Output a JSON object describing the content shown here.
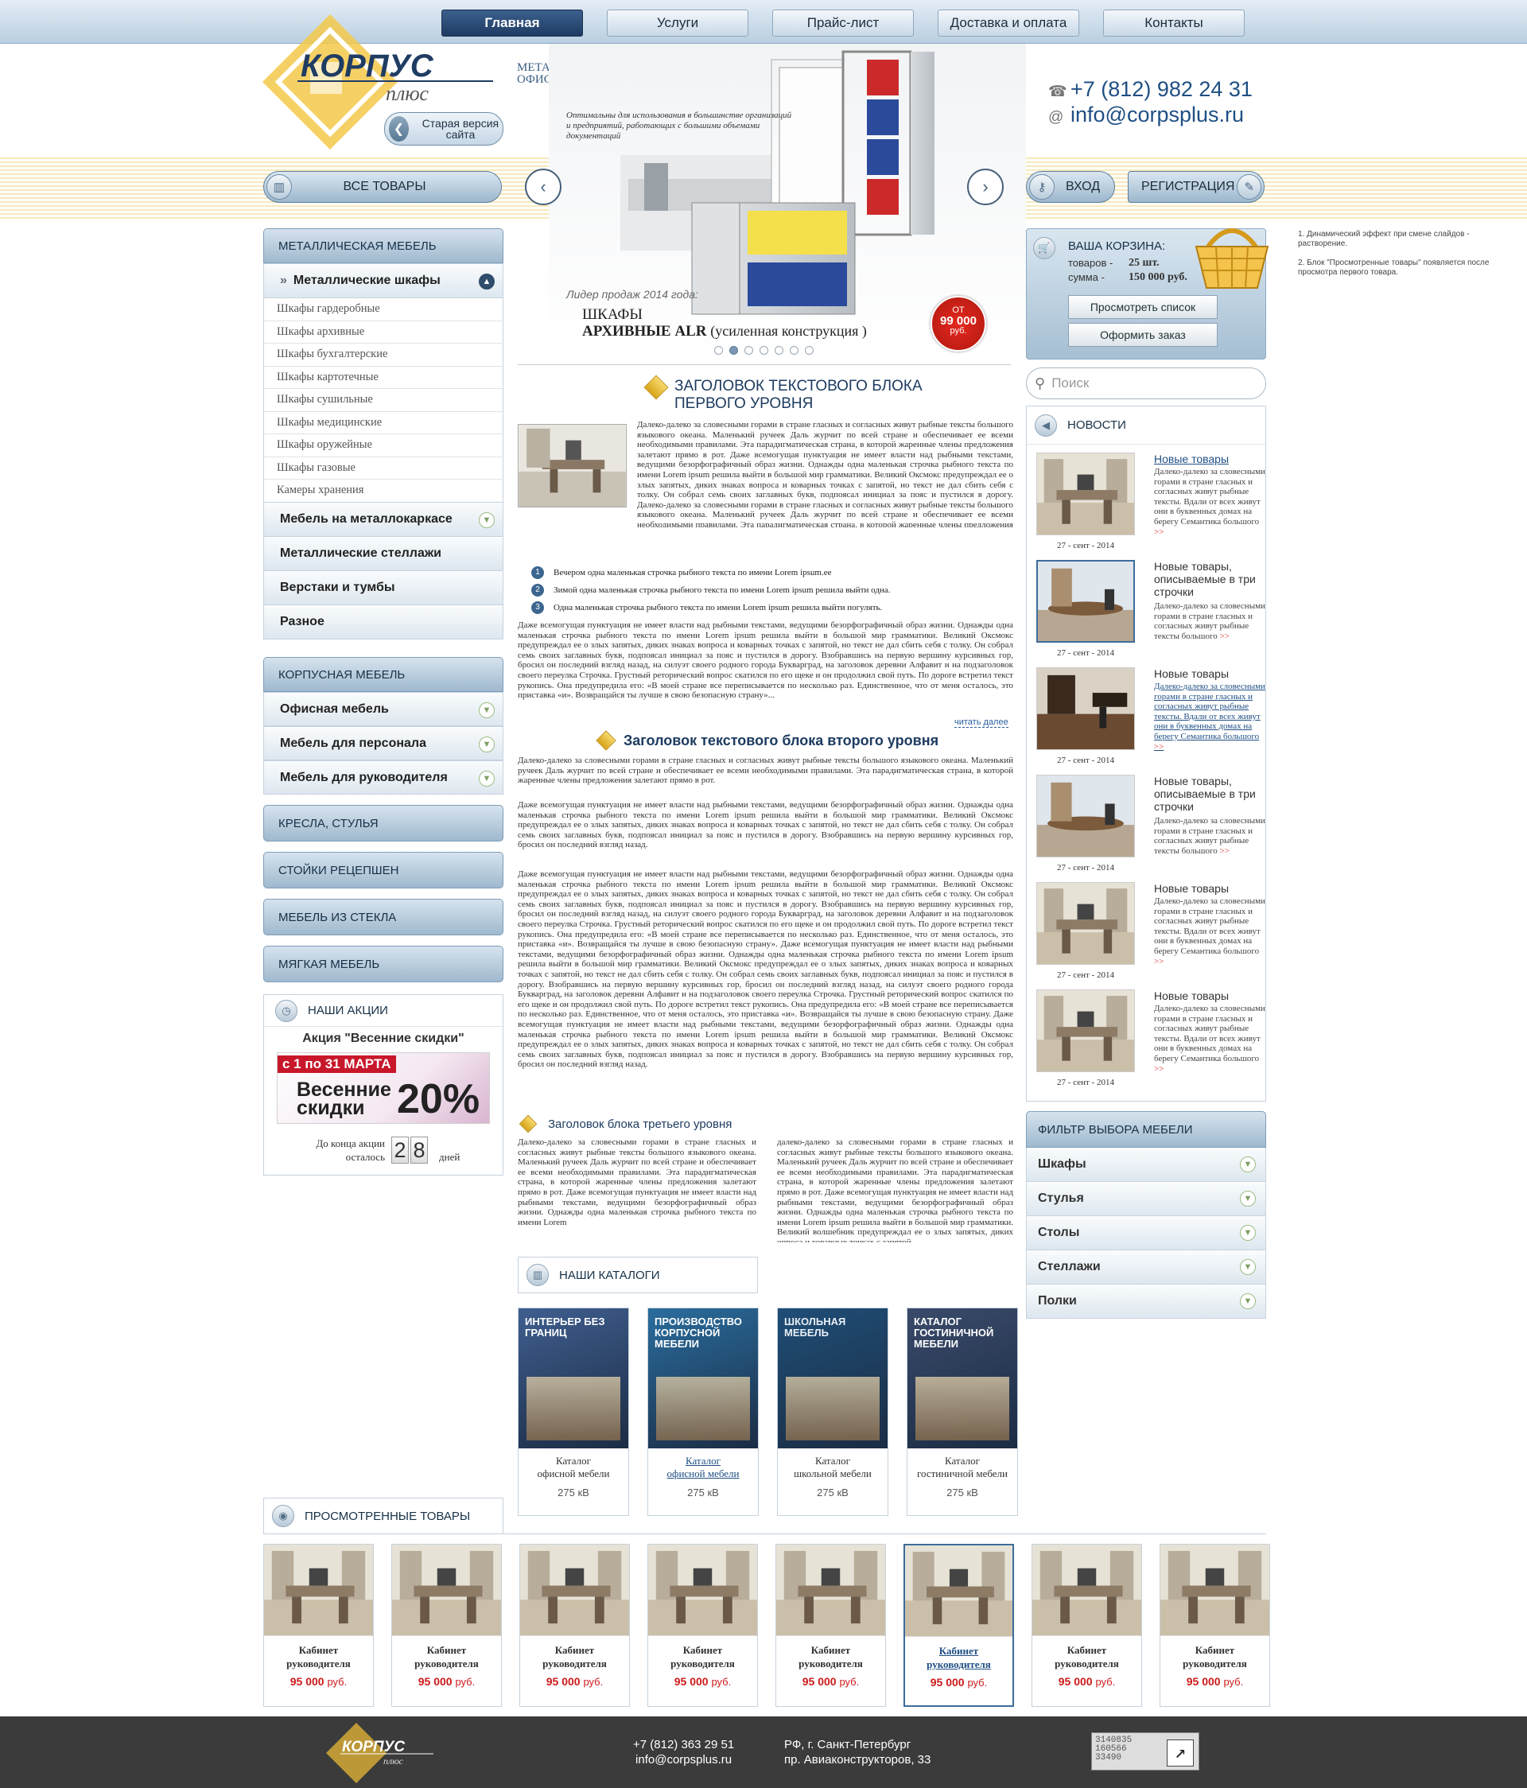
{
  "nav": {
    "items": [
      {
        "label": "Главная"
      },
      {
        "label": "Услуги"
      },
      {
        "label": "Прайс-лист"
      },
      {
        "label": "Доставка и оплата"
      },
      {
        "label": "Контакты"
      }
    ]
  },
  "header": {
    "tagline": "МЕТАЛЛИЧЕСКАЯ И ОФИСНАЯ МЕБЕЛЬ",
    "old_version": "Старая версия сайта",
    "hero_caption": "Оптимальны для использования в большинстве организаций и предприятий, работающих с большими объемами документаций",
    "phone": "+7 (812) 982 24 31",
    "email": "info@corpsplus.ru"
  },
  "toolbar": {
    "all_goods": "ВСЕ ТОВАРЫ",
    "login": "ВХОД",
    "register": "РЕГИСТРАЦИЯ"
  },
  "hero": {
    "leader": "Лидер продаж 2014 года:",
    "title_line1": "ШКАФЫ",
    "title_line2": "АРХИВНЫЕ ALR",
    "title_note": "(усиленная конструкция )",
    "price_from": "ОТ",
    "price": "99 000",
    "price_unit": "руб.",
    "dots_total": 7,
    "dots_active": 2
  },
  "sidebar": {
    "metal_head": "МЕТАЛЛИЧЕСКАЯ МЕБЕЛЬ",
    "metal_open": "Металлические шкафы",
    "metal_leaves": [
      "Шкафы гардеробные",
      "Шкафы архивные",
      "Шкафы бухгалтерские",
      "Шкафы картотечные",
      "Шкафы сушильные",
      "Шкафы медицинские",
      "Шкафы оружейные",
      "Шкафы газовые",
      "Камеры хранения"
    ],
    "metal_more": [
      "Мебель на металлокаркасе",
      "Металлические стеллажи",
      "Верстаки и тумбы",
      "Разное"
    ],
    "corp_head": "КОРПУСНАЯ МЕБЕЛЬ",
    "corp_items": [
      "Офисная мебель",
      "Мебель для персонала",
      "Мебель для руководителя"
    ],
    "buttons": [
      "КРЕСЛА, СТУЛЬЯ",
      "СТОЙКИ РЕЦЕПШЕН",
      "МЕБЕЛЬ ИЗ СТЕКЛА",
      "МЯГКАЯ МЕБЕЛЬ"
    ]
  },
  "promo": {
    "head": "НАШИ АКЦИИ",
    "title": "Акция \"Весенние скидки\"",
    "banner_dates": "с 1 по 31 МАРТА",
    "banner_text1": "Весенние",
    "banner_text2": "скидки",
    "banner_pct": "20%",
    "remaining_label": "До конца акции осталось",
    "digits": [
      "2",
      "8"
    ],
    "days": "дней"
  },
  "content": {
    "h1": "ЗАГОЛОВОК ТЕКСТОВОГО БЛОКА ПЕРВОГО УРОВНЯ",
    "p1": "Далеко-далеко за словесными горами в стране гласных и согласных живут рыбные тексты большого языкового океана. Маленький ручеек Даль журчит по всей стране и обеспечивает ее всеми необходимыми правилами. Эта парадигматическая страна, в которой жаренные члены предложения залетают прямо в рот. Даже всемогущая пунктуация не имеет власти над рыбными текстами, ведущими безорфографичный образ жизни. Однажды одна маленькая строчка рыбного текста по имени Lorem ipsum решила выйти в большой мир грамматики. Великий Оксмокс предупреждал ее о злых запятых, диких знаках вопроса и коварных точках с запятой, но текст не дал сбить себя с толку. Он собрал семь своих заглавных букв, подпоясал инициал за пояс и пустился в дорогу. Далеко-далеко за словесными горами в стране гласных и согласных живут рыбные тексты большого языкового океана. Маленький ручеек Даль журчит по всей стране и обеспечивает ее всеми необходимыми правилами. Эта парадигматическая страна, в которой жаренные члены предложения залетают прямо в рот.",
    "list": [
      "Вечером одна маленькая строчка рыбного текста по имени Lorem ipsum.ee",
      "Зимой одна маленькая строчка рыбного текста по имени Lorem ipsum решила выйти одна.",
      "Одна маленькая строчка рыбного текста по имени Lorem ipsum решила выйти погулять."
    ],
    "p2": "Даже всемогущая пунктуация не имеет власти над рыбными текстами, ведущими безорфографичный образ жизни. Однажды одна маленькая строчка рыбного текста по имени Lorem ipsum решила выйти в большой мир грамматики. Великий Оксмокс предупреждал ее о злых запятых, диких знаках вопроса и коварных точках с запятой, но текст не дал сбить себя с толку. Он собрал семь своих заглавных букв, подпоясал инициал за пояс и пустился в дорогу. Взобравшись на первую вершину курсивных гор, бросил он последний взгляд назад, на силуэт своего родного города Букварград, на заголовок деревни Алфавит и на подзаголовок своего переулка Строчка. Грустный реторический вопрос скатился по его щеке и он продолжил свой путь. По дороге встретил текст рукопись. Она предупредила его: «В моей стране все переписывается по несколько раз. Единственное, что от меня осталось, это приставка «и». Возвращайся ты лучше в свою безопасную страну»...",
    "more": "читать далее",
    "h2": "Заголовок текстового блока второго уровня",
    "p3": "Далеко-далеко за словесными горами в стране гласных и согласных живут рыбные тексты большого языкового океана. Маленький ручеек Даль журчит по всей стране и обеспечивает ее всеми необходимыми правилами. Эта парадигматическая страна, в которой жаренные члены предложения залетают прямо в рот.",
    "p4": "Даже всемогущая пунктуация не имеет власти над рыбными текстами, ведущими безорфографичный образ жизни. Однажды одна маленькая строчка рыбного текста по имени Lorem ipsum решила выйти в большой мир грамматики. Великий Оксмокс предупреждал ее о злых запятых, диких знаках вопроса и коварных точках с запятой, но текст не дал сбить себя с толку. Он собрал семь своих заглавных букв, подпоясал инициал за пояс и пустился в дорогу. Взобравшись на первую вершину курсивных гор, бросил он последний взгляд назад.",
    "p5": "Даже всемогущая пунктуация не имеет власти над рыбными текстами, ведущими безорфографичный образ жизни. Однажды одна маленькая строчка рыбного текста по имени Lorem ipsum решила выйти в большой мир грамматики. Великий Оксмокс предупреждал ее о злых запятых, диких знаках вопроса и коварных точках с запятой, но текст не дал сбить себя с толку. Он собрал семь своих заглавных букв, подпоясал инициал за пояс и пустился в дорогу. Взобравшись на первую вершину курсивных гор, бросил он последний взгляд назад, на силуэт своего родного города Букварград, на заголовок деревни Алфавит и на подзаголовок своего переулка Строчка. Грустный реторический вопрос скатился по его щеке и он продолжил свой путь. По дороге встретил текст рукопись. Она предупредила его: «В моей стране все переписывается по несколько раз. Единственное, что от меня осталось, это приставка «и». Возвращайся ты лучше в свою безопасную страну». Даже всемогущая пунктуация не имеет власти над рыбными текстами, ведущими безорфографичный образ жизни. Однажды одна маленькая строчка рыбного текста по имени Lorem ipsum решила выйти в большой мир грамматики. Великий Оксмокс предупреждал ее о злых запятых, диких знаках вопроса и коварных точках с запятой, но текст не дал сбить себя с толку. Он собрал семь своих заглавных букв, подпоясал инициал за пояс и пустился в дорогу. Взобравшись на первую вершину курсивных гор, бросил он последний взгляд назад, на силуэт своего родного города Букварград, на заголовок деревни Алфавит и на подзаголовок своего переулка Строчка. Грустный реторический вопрос скатился по его щеке и он продолжил свой путь. По дороге встретил текст рукопись. Она предупредила его: «В моей стране все переписывается по несколько раз. Единственное, что от меня осталось, это приставка «и». Возвращайся ты лучше в свою безопасную страну. Даже всемогущая пунктуация не имеет власти над рыбными текстами, ведущими безорфографичный образ жизни. Однажды одна маленькая строчка рыбного текста по имени Lorem ipsum решила выйти в большой мир грамматики. Великий Оксмокс предупреждал ее о злых запятых, диких знаках вопроса и коварных точках с запятой, но текст не дал сбить себя с толку. Он собрал семь своих заглавных букв, подпоясал инициал за пояс и пустился в дорогу. Взобравшись на первую вершину курсивных гор, бросил он последний взгляд назад.",
    "h3": "Заголовок блока третьего уровня",
    "col1": "Далеко-далеко за словесными горами в стране гласных и согласных живут рыбные тексты большого языкового океана. Маленький ручеек Даль журчит по всей стране и обеспечивает ее всеми необходимыми правилами. Эта парадигматическая страна, в которой жаренные члены предложения залетают прямо в рот. Даже всемогущая пунктуация не имеет власти над рыбными текстами, ведущими безорфографичный образ жизни. Однажды одна маленькая строчка рыбного текста по имени Lorem",
    "col2": "далеко-далеко за словесными горами в стране гласных и согласных живут рыбные тексты большого языкового океана. Маленький ручеек Даль журчит по всей стране и обеспечивает ее всеми необходимыми правилами. Эта парадигматическая страна, в которой жаренные члены предложения залетают прямо в рот. Даже всемогущая пунктуация не имеет власти над рыбными текстами, ведущими безорфографичный образ жизни. Однажды одна маленькая строчка рыбного текста по имени Lorem ipsum решила выйти в большой мир грамматики. Великий волшебник предупреждал ее о злых запятых, диких опроса и коварных точках с запятой."
  },
  "catalogs": {
    "head": "НАШИ КАТАЛОГИ",
    "items": [
      {
        "title1": "Каталог",
        "title2": "офисной мебели",
        "size": "275 кВ",
        "cover": "ИНТЕРЬЕР БЕЗ ГРАНИЦ"
      },
      {
        "title1": "Каталог",
        "title2": "офисной мебели",
        "size": "275 кВ",
        "cover": "ПРОИЗВОДСТВО КОРПУСНОЙ МЕБЕЛИ"
      },
      {
        "title1": "Каталог",
        "title2": "школьной мебели",
        "size": "275 кВ",
        "cover": "ШКОЛЬНАЯ МЕБЕЛЬ"
      },
      {
        "title1": "Каталог",
        "title2": "гостиничной мебели",
        "size": "275 кВ",
        "cover": "КАТАЛОГ ГОСТИНИЧНОЙ МЕБЕЛИ"
      }
    ]
  },
  "cart": {
    "title": "ВАША КОРЗИНА:",
    "goods_label": "товаров -",
    "goods_val": "25 шт.",
    "sum_label": "сумма -",
    "sum_val": "150 000 руб.",
    "view_btn": "Просмотреть список",
    "order_btn": "Оформить заказ"
  },
  "search": {
    "placeholder": "Поиск"
  },
  "news": {
    "head": "НОВОСТИ",
    "items": [
      {
        "title": "Новые товары",
        "text": "Далеко-далеко за словесными горами в стране гласных и согласных живут рыбные тексты. Вдали от всех живут они в буквенных домах на берегу Семантика большого",
        "date": "27 - сент - 2014"
      },
      {
        "title": "Новые товары, описываемые в три строчки",
        "text": "Далеко-далеко за словесными горами в стране гласных и согласных живут рыбные тексты большого",
        "date": "27 - сент - 2014"
      },
      {
        "title": "Новые товары",
        "text": "Далеко-далеко за словесными горами в стране гласных и согласных живут рыбные тексты. Вдали от всех живут они в буквенных домах на берегу Семантика большого",
        "date": "27 - сент - 2014"
      },
      {
        "title": "Новые товары, описываемые в три строчки",
        "text": "Далеко-далеко за словесными горами в стране гласных и согласных живут рыбные тексты большого",
        "date": "27 - сент - 2014"
      },
      {
        "title": "Новые товары",
        "text": "Далеко-далеко за словесными горами в стране гласных и согласных живут рыбные тексты. Вдали от всех живут они в буквенных домах на берегу Семантика большого",
        "date": "27 - сент - 2014"
      },
      {
        "title": "Новые товары",
        "text": "Далеко-далеко за словесными горами в стране гласных и согласных живут рыбные тексты. Вдали от всех живут они в буквенных домах на берегу Семантика большого",
        "date": "27 - сент - 2014"
      }
    ]
  },
  "filter": {
    "head": "ФИЛЬТР ВЫБОРА МЕБЕЛИ",
    "items": [
      "Шкафы",
      "Стулья",
      "Столы",
      "Стеллажи",
      "Полки"
    ]
  },
  "notes": {
    "n1": "1. Динамический эффект при смене слайдов - растворение.",
    "n2": "2. Блок \"Просмотренные товары\" появляется после просмотра первого товара."
  },
  "viewed": {
    "head": "ПРОСМОТРЕННЫЕ ТОВАРЫ",
    "name1": "Кабинет",
    "name2": "руководителя",
    "price": "95 000",
    "unit": "руб.",
    "count": 8,
    "selected": 5
  },
  "footer": {
    "phone": "+7 (812) 363 29 51",
    "email": "info@corpsplus.ru",
    "addr1": "РФ, г. Санкт-Петербург",
    "addr2": "пр. Авиаконструкторов, 33",
    "counter": [
      "3140835",
      "160566",
      "33490"
    ]
  },
  "colors": {
    "accent": "#1f4f84",
    "price": "#cc1a1a",
    "nav_active": "#2a4a73"
  }
}
